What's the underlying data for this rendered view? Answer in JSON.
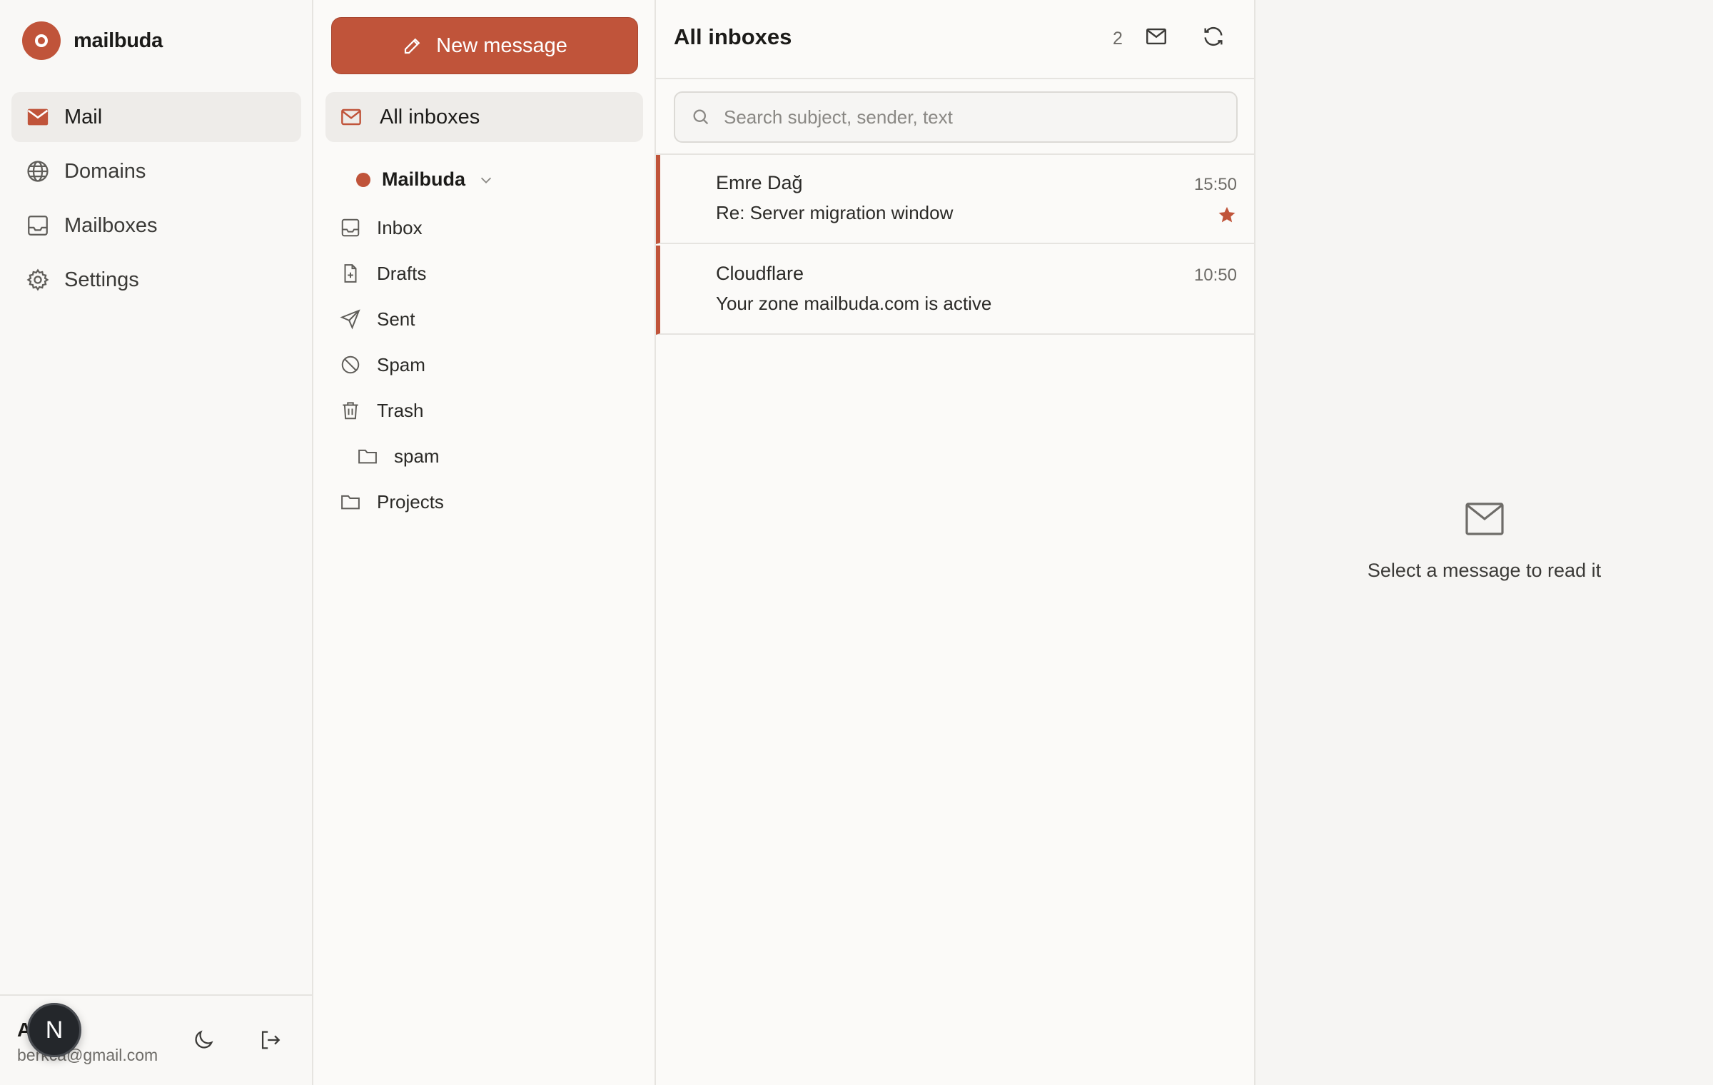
{
  "app": {
    "name": "mailbuda",
    "accent_color": "#c0543a"
  },
  "nav": {
    "items": [
      {
        "label": "Mail",
        "icon": "mail-icon",
        "active": true
      },
      {
        "label": "Domains",
        "icon": "globe-icon",
        "active": false
      },
      {
        "label": "Mailboxes",
        "icon": "inbox-tray-icon",
        "active": false
      },
      {
        "label": "Settings",
        "icon": "gear-icon",
        "active": false
      }
    ]
  },
  "user": {
    "initial": "A",
    "email": "berkca@gmail.com",
    "avatar_letter": "N"
  },
  "folders": {
    "compose_label": "New message",
    "all_inboxes_label": "All inboxes",
    "account_name": "Mailbuda",
    "items": [
      {
        "label": "Inbox",
        "icon": "inbox-tray-icon"
      },
      {
        "label": "Drafts",
        "icon": "draft-file-icon"
      },
      {
        "label": "Sent",
        "icon": "send-icon"
      },
      {
        "label": "Spam",
        "icon": "ban-icon"
      },
      {
        "label": "Trash",
        "icon": "trash-icon"
      },
      {
        "label": "spam",
        "icon": "folder-icon",
        "nested": true
      },
      {
        "label": "Projects",
        "icon": "folder-icon"
      }
    ]
  },
  "list": {
    "title": "All inboxes",
    "count": "2",
    "search_placeholder": "Search subject, sender, text",
    "messages": [
      {
        "from": "Emre Dağ",
        "subject": "Re: Server migration window",
        "time": "15:50",
        "starred": true
      },
      {
        "from": "Cloudflare",
        "subject": "Your zone mailbuda.com is active",
        "time": "10:50",
        "starred": false
      }
    ]
  },
  "reader": {
    "empty_text": "Select a message to read it",
    "empty_icon": "mail-icon"
  }
}
